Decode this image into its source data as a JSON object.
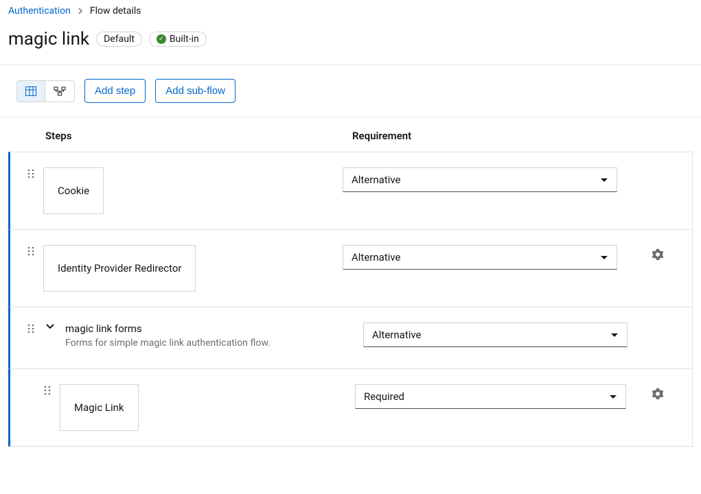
{
  "breadcrumbs": {
    "root": "Authentication",
    "current": "Flow details"
  },
  "header": {
    "title": "magic link",
    "tag_default": "Default",
    "tag_builtin": "Built-in"
  },
  "toolbar": {
    "add_step": "Add step",
    "add_subflow": "Add sub-flow"
  },
  "columns": {
    "steps": "Steps",
    "requirement": "Requirement"
  },
  "steps": [
    {
      "id": "cookie",
      "label": "Cookie",
      "kind": "boxed",
      "indent": 0,
      "requirement": "Alternative",
      "has_settings": false
    },
    {
      "id": "idp-redirector",
      "label": "Identity Provider Redirector",
      "kind": "boxed",
      "indent": 0,
      "requirement": "Alternative",
      "has_settings": true
    },
    {
      "id": "magic-link-forms",
      "label": "magic link forms",
      "description": "Forms for simple magic link authentication flow.",
      "kind": "flow",
      "indent": 0,
      "requirement": "Alternative",
      "has_settings": false,
      "expanded": true
    },
    {
      "id": "magic-link",
      "label": "Magic Link",
      "kind": "boxed",
      "indent": 1,
      "requirement": "Required",
      "has_settings": true
    }
  ]
}
